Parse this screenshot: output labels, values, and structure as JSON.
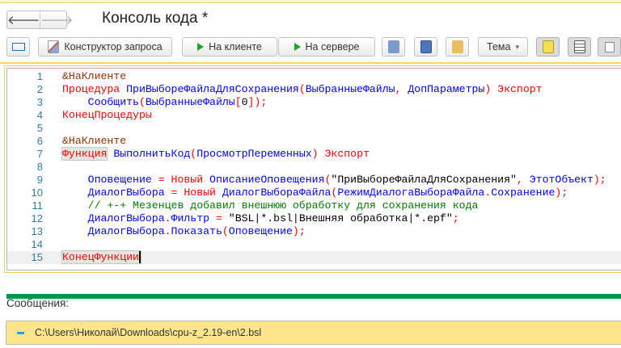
{
  "window": {
    "title": "Консоль кода *"
  },
  "nav": {
    "back": "🡐",
    "forward": "🡒"
  },
  "toolbar": {
    "query_builder": "Конструктор запроса",
    "on_client": "На клиенте",
    "on_server": "На сервере",
    "theme": "Тема",
    "theme_arrow": "▾"
  },
  "editor": {
    "lines": [
      {
        "n": "1",
        "tokens": [
          {
            "t": "&НаКлиенте",
            "c": "pp"
          }
        ]
      },
      {
        "n": "2",
        "tokens": [
          {
            "t": "Процедура",
            "c": "kw"
          },
          {
            "t": " ПриВыбореФайлаДляСохранения",
            "c": "id"
          },
          {
            "t": "(",
            "c": "pn"
          },
          {
            "t": "ВыбранныеФайлы",
            "c": "id"
          },
          {
            "t": ", ",
            "c": "pn"
          },
          {
            "t": "ДопПараметры",
            "c": "id"
          },
          {
            "t": ") ",
            "c": "pn"
          },
          {
            "t": "Экспорт",
            "c": "kw"
          }
        ]
      },
      {
        "n": "3",
        "tokens": [
          {
            "t": "    Сообщить",
            "c": "id"
          },
          {
            "t": "(",
            "c": "pn"
          },
          {
            "t": "ВыбранныеФайлы",
            "c": "id"
          },
          {
            "t": "[",
            "c": "pn"
          },
          {
            "t": "0",
            "c": "st"
          },
          {
            "t": "]);",
            "c": "pn"
          }
        ]
      },
      {
        "n": "4",
        "tokens": [
          {
            "t": "КонецПроцедуры",
            "c": "kw"
          }
        ]
      },
      {
        "n": "5",
        "tokens": []
      },
      {
        "n": "6",
        "tokens": [
          {
            "t": "&НаКлиенте",
            "c": "pp"
          }
        ]
      },
      {
        "n": "7",
        "tokens": [
          {
            "t": "Функция",
            "c": "kw hl"
          },
          {
            "t": " ВыполнитьКод",
            "c": "id"
          },
          {
            "t": "(",
            "c": "pn"
          },
          {
            "t": "ПросмотрПеременных",
            "c": "id"
          },
          {
            "t": ") ",
            "c": "pn"
          },
          {
            "t": "Экспорт",
            "c": "kw"
          }
        ]
      },
      {
        "n": "8",
        "tokens": []
      },
      {
        "n": "9",
        "tokens": [
          {
            "t": "    Оповещение",
            "c": "id"
          },
          {
            "t": " = ",
            "c": "pn"
          },
          {
            "t": "Новый",
            "c": "kw"
          },
          {
            "t": " ОписаниеОповещения",
            "c": "id"
          },
          {
            "t": "(",
            "c": "pn"
          },
          {
            "t": "\"ПриВыбореФайлаДляСохранения\"",
            "c": "st"
          },
          {
            "t": ", ",
            "c": "pn"
          },
          {
            "t": "ЭтотОбъект",
            "c": "id"
          },
          {
            "t": ");",
            "c": "pn"
          }
        ]
      },
      {
        "n": "10",
        "tokens": [
          {
            "t": "    ДиалогВыбора",
            "c": "id"
          },
          {
            "t": " = ",
            "c": "pn"
          },
          {
            "t": "Новый",
            "c": "kw"
          },
          {
            "t": " ДиалогВыбораФайла",
            "c": "id"
          },
          {
            "t": "(",
            "c": "pn"
          },
          {
            "t": "РежимДиалогаВыбораФайла",
            "c": "id"
          },
          {
            "t": ".",
            "c": "pn"
          },
          {
            "t": "Сохранение",
            "c": "id"
          },
          {
            "t": ");",
            "c": "pn"
          }
        ]
      },
      {
        "n": "11",
        "tokens": [
          {
            "t": "    // +-+ Мезенцев добавил внешнюю обработку для сохранения кода",
            "c": "cm"
          }
        ]
      },
      {
        "n": "12",
        "tokens": [
          {
            "t": "    ДиалогВыбора",
            "c": "id"
          },
          {
            "t": ".",
            "c": "pn"
          },
          {
            "t": "Фильтр",
            "c": "id"
          },
          {
            "t": " = ",
            "c": "pn"
          },
          {
            "t": "\"BSL|*.bsl|Внешняя обработка|*.epf\"",
            "c": "st"
          },
          {
            "t": ";",
            "c": "pn"
          }
        ]
      },
      {
        "n": "13",
        "tokens": [
          {
            "t": "    ДиалогВыбора",
            "c": "id"
          },
          {
            "t": ".",
            "c": "pn"
          },
          {
            "t": "Показать",
            "c": "id"
          },
          {
            "t": "(",
            "c": "pn"
          },
          {
            "t": "Оповещение",
            "c": "id"
          },
          {
            "t": ");",
            "c": "pn"
          }
        ]
      },
      {
        "n": "14",
        "tokens": []
      },
      {
        "n": "15",
        "tokens": [
          {
            "t": "КонецФункции",
            "c": "kw hl cur"
          }
        ]
      }
    ]
  },
  "messages": {
    "label": "Сообщения:",
    "items": [
      "C:\\Users\\Николай\\Downloads\\cpu-z_2.19-en\\2.bsl"
    ]
  }
}
